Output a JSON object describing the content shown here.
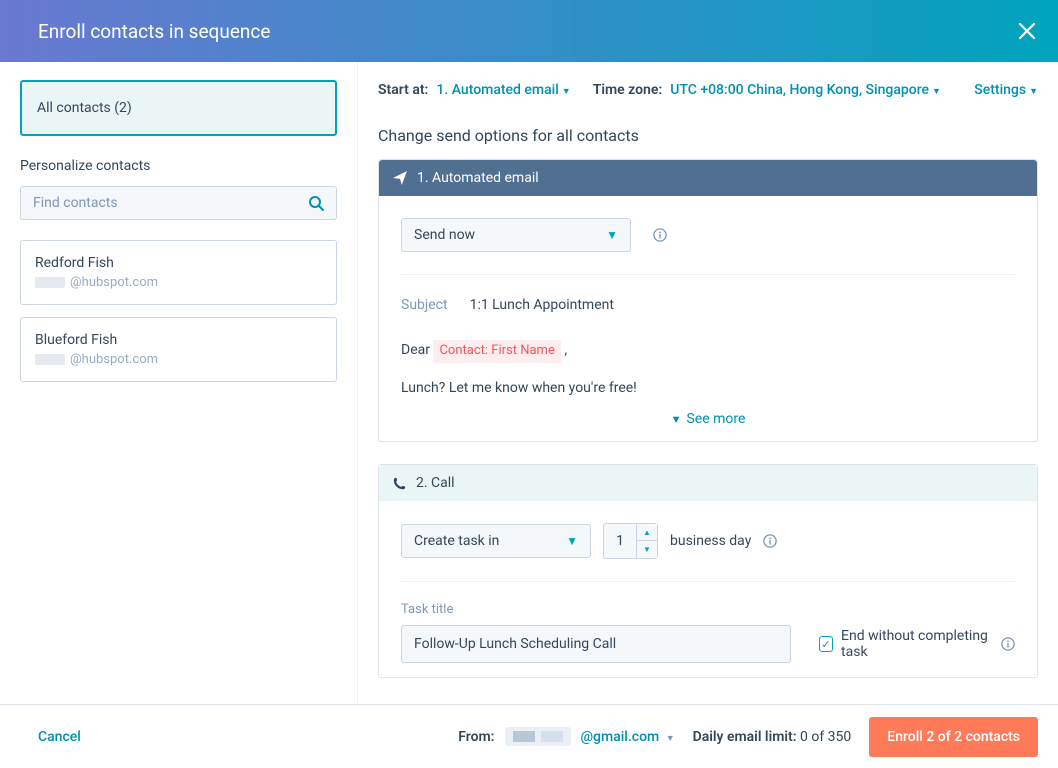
{
  "header": {
    "title": "Enroll contacts in sequence"
  },
  "sidebar": {
    "all_contacts_label": "All contacts (2)",
    "personalize_label": "Personalize contacts",
    "search_placeholder": "Find contacts",
    "contacts": [
      {
        "name": "Redford Fish",
        "email_suffix": "@hubspot.com"
      },
      {
        "name": "Blueford Fish",
        "email_suffix": "@hubspot.com"
      }
    ]
  },
  "content": {
    "start_at_label": "Start at:",
    "start_at_value": "1. Automated email",
    "timezone_label": "Time zone:",
    "timezone_value": "UTC +08:00 China, Hong Kong, Singapore",
    "settings_label": "Settings",
    "change_heading": "Change send options for all contacts",
    "steps": {
      "step1": {
        "title": "1. Automated email",
        "send_option": "Send now",
        "subject_label": "Subject",
        "subject_value": "1:1 Lunch Appointment",
        "body_greeting_prefix": "Dear ",
        "body_token": "Contact: First Name",
        "body_greeting_suffix": ",",
        "body_line": "Lunch? Let me know when you're free!",
        "see_more": "See more"
      },
      "step2": {
        "title": "2. Call",
        "task_dropdown": "Create task in",
        "days_value": "1",
        "business_day_label": "business day",
        "task_title_label": "Task title",
        "task_title_value": "Follow-Up Lunch Scheduling Call",
        "end_without_label": "End without completing task"
      }
    }
  },
  "footer": {
    "cancel": "Cancel",
    "from_label": "From:",
    "from_email_suffix": "@gmail.com",
    "limit_label": "Daily email limit:",
    "limit_value": "0 of 350",
    "enroll_button": "Enroll 2 of 2 contacts"
  }
}
